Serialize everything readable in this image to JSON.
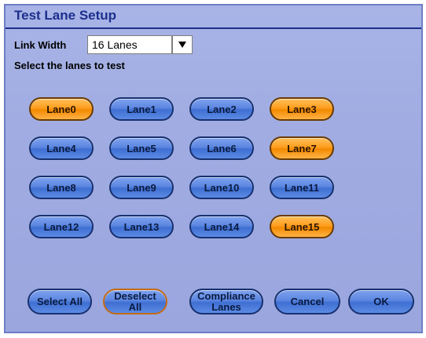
{
  "dialog": {
    "title": "Test Lane Setup",
    "link_width_label": "Link Width",
    "link_width_value": "16 Lanes",
    "select_lanes_label": "Select the lanes to test"
  },
  "lanes": [
    {
      "label": "Lane0",
      "selected": true
    },
    {
      "label": "Lane1",
      "selected": false
    },
    {
      "label": "Lane2",
      "selected": false
    },
    {
      "label": "Lane3",
      "selected": true
    },
    {
      "label": "Lane4",
      "selected": false
    },
    {
      "label": "Lane5",
      "selected": false
    },
    {
      "label": "Lane6",
      "selected": false
    },
    {
      "label": "Lane7",
      "selected": true
    },
    {
      "label": "Lane8",
      "selected": false
    },
    {
      "label": "Lane9",
      "selected": false
    },
    {
      "label": "Lane10",
      "selected": false
    },
    {
      "label": "Lane11",
      "selected": false
    },
    {
      "label": "Lane12",
      "selected": false
    },
    {
      "label": "Lane13",
      "selected": false
    },
    {
      "label": "Lane14",
      "selected": false
    },
    {
      "label": "Lane15",
      "selected": true
    }
  ],
  "buttons": {
    "select_all": "Select All",
    "deselect_line1": "Deselect",
    "deselect_line2": "All",
    "compliance_line1": "Compliance",
    "compliance_line2": "Lanes",
    "cancel": "Cancel",
    "ok": "OK"
  },
  "icons": {
    "dropdown": "triangle-down-icon"
  },
  "colors": {
    "selected_lane": "#f28a00",
    "unselected_lane": "#4f7cdc",
    "title": "#1d2f8c",
    "dialog_bg": "#a3afe3"
  }
}
